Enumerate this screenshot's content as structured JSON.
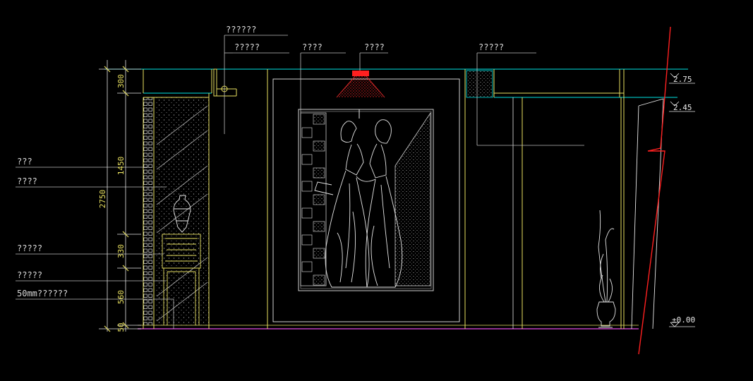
{
  "annotations": {
    "top_1": "??????",
    "top_2": "?????",
    "top_3": "????",
    "top_light": "????",
    "top_right": "?????",
    "left_1": "???",
    "left_2": "????",
    "left_3": "?????",
    "left_4": "?????",
    "left_5": "50mm??????"
  },
  "dimensions": {
    "total": "2750",
    "seg_top": "300",
    "seg_mid": "1450",
    "seg_cabinet": "330",
    "seg_legs": "560",
    "seg_base": "50"
  },
  "levels": {
    "ceiling_top": "2.75",
    "ceiling_low": "2.45",
    "floor": "±0.00"
  },
  "colors": {
    "background": "#000000",
    "cyan": "#00e5e5",
    "yellow": "#e8e060",
    "white": "#e6e6e6",
    "red": "#ff2020",
    "magenta": "#c040c0"
  }
}
